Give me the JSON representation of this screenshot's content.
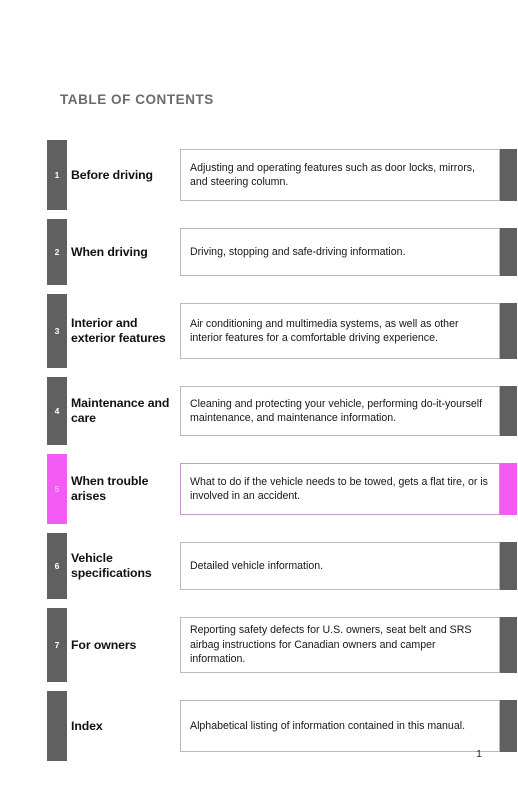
{
  "document": {
    "title": "TABLE OF CONTENTS",
    "page_number": "1"
  },
  "colors": {
    "tab_default": "#606060",
    "tab_active": "#f45bf4",
    "heading_text": "#6b6b6b",
    "box_border": "#b9b9b9",
    "box_border_active": "#c89ac3",
    "page_background": "#ffffff"
  },
  "contents": {
    "rows": [
      {
        "number": "1",
        "title": "Before driving",
        "description": "Adjusting and operating features such as door locks, mirrors, and steering column.",
        "active": false
      },
      {
        "number": "2",
        "title": "When driving",
        "description": "Driving, stopping and safe-driving information.",
        "active": false
      },
      {
        "number": "3",
        "title": "Interior and exterior features",
        "description": "Air conditioning and multimedia systems, as well as other interior features for a comfortable driving experience.",
        "active": false
      },
      {
        "number": "4",
        "title": "Maintenance and care",
        "description": "Cleaning and protecting your vehicle, performing do-it-yourself maintenance, and maintenance information.",
        "active": false
      },
      {
        "number": "5",
        "title": "When trouble arises",
        "description": "What to do if the vehicle needs to be towed, gets a flat tire, or is involved in an accident.",
        "active": true
      },
      {
        "number": "6",
        "title": "Vehicle specifications",
        "description": "Detailed vehicle information.",
        "active": false
      },
      {
        "number": "7",
        "title": "For owners",
        "description": "Reporting safety defects for U.S. owners, seat belt and SRS airbag instructions for Canadian owners and camper information.",
        "active": false
      },
      {
        "number": "",
        "title": "Index",
        "description": "Alphabetical listing of information contained in this manual.",
        "active": false
      }
    ]
  }
}
